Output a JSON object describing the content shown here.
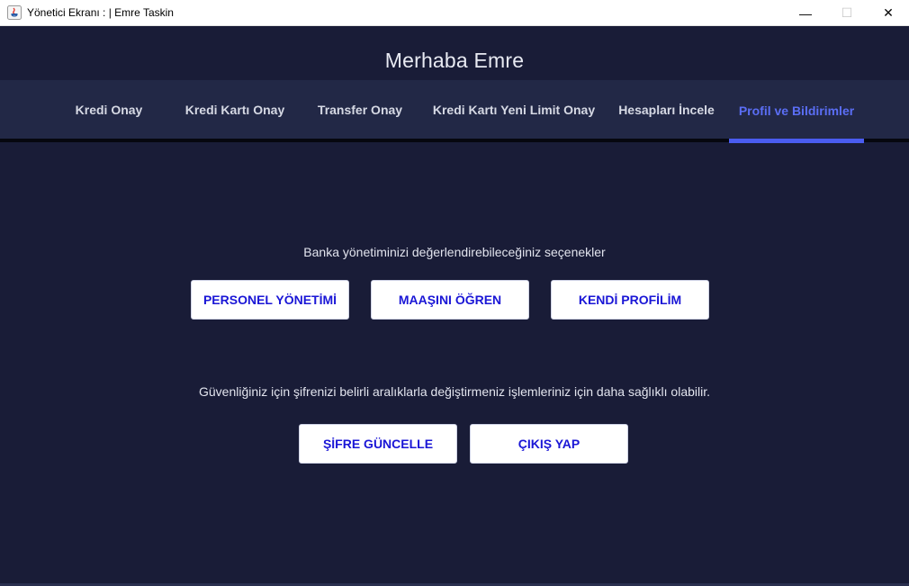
{
  "window": {
    "title": "Yönetici Ekranı : | Emre Taskin",
    "icon": "java-app-icon",
    "controls": {
      "minimize_glyph": "—",
      "maximize_glyph": "☐",
      "close_glyph": "✕"
    }
  },
  "header": {
    "greeting": "Merhaba Emre"
  },
  "tabs": [
    {
      "label": "Kredi Onay",
      "active": false
    },
    {
      "label": "Kredi Kartı Onay",
      "active": false
    },
    {
      "label": "Transfer Onay",
      "active": false
    },
    {
      "label": "Kredi Kartı Yeni Limit Onay",
      "active": false
    },
    {
      "label": "Hesapları İncele",
      "active": false
    },
    {
      "label": "Profil ve Bildirimler",
      "active": true
    }
  ],
  "content": {
    "management_text": "Banka yönetiminizi değerlendirebileceğiniz seçenekler",
    "management_buttons": {
      "personnel": "PERSONEL YÖNETİMİ",
      "salary": "MAAŞINI ÖĞREN",
      "profile": "KENDİ PROFİLİM"
    },
    "security_text": "Güvenliğiniz için şifrenizi belirli aralıklarla değiştirmeniz işlemleriniz için daha sağlıklı olabilir.",
    "security_buttons": {
      "update_password": "ŞİFRE GÜNCELLE",
      "logout": "ÇIKIŞ YAP"
    }
  },
  "colors": {
    "background": "#191c37",
    "tabbar": "#222846",
    "active_tab": "#5b6ef5",
    "button_text": "#1a16d6"
  }
}
